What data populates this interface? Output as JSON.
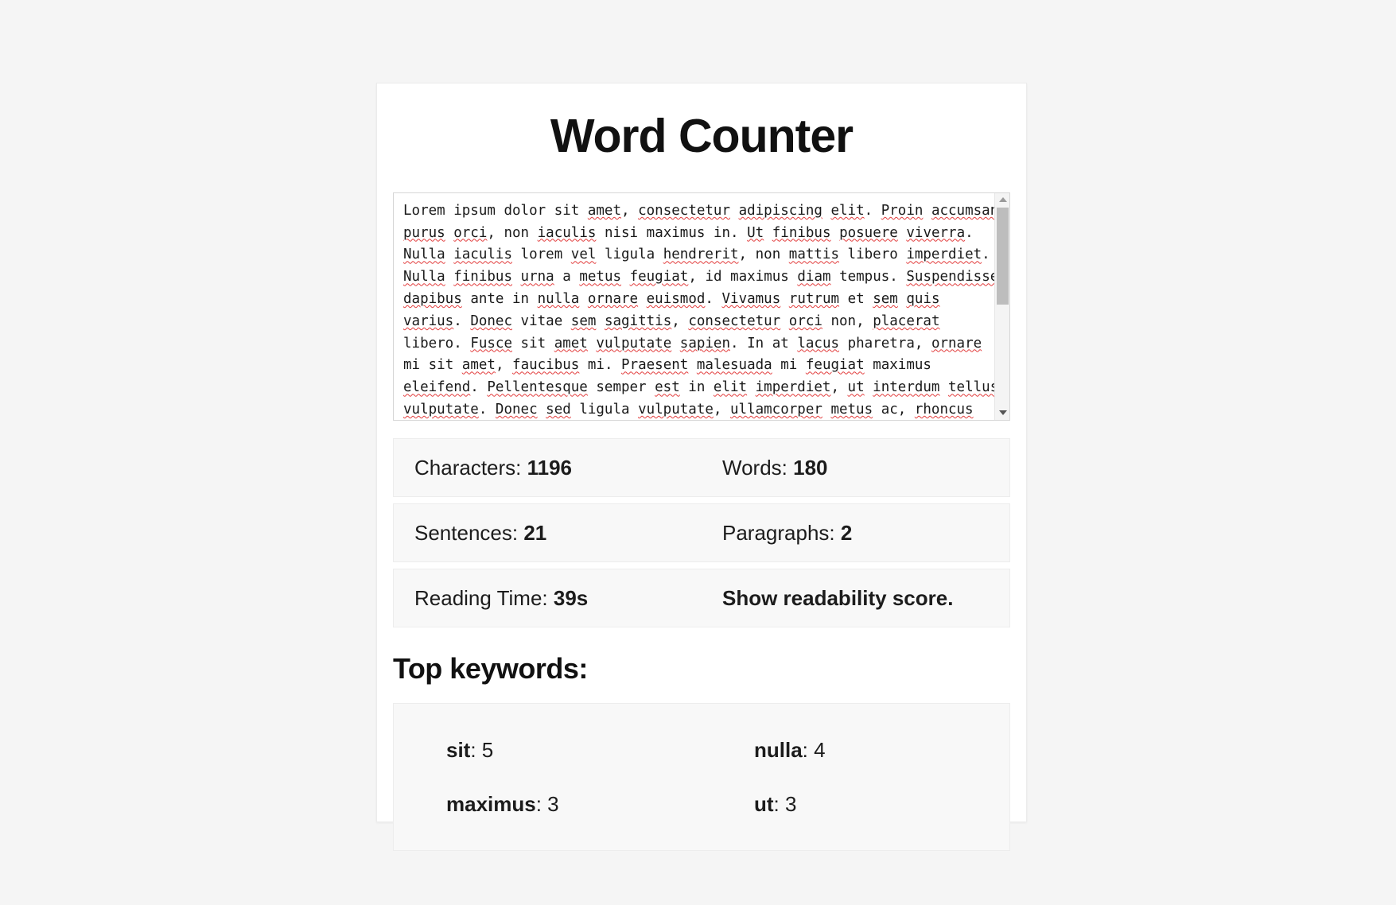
{
  "app": {
    "title": "Word Counter",
    "background_color": "#f5f5f5",
    "card_color": "#ffffff",
    "stat_box_color": "#f8f8f8",
    "spellcheck_underline_color": "#e23b3b"
  },
  "editor": {
    "lines": [
      "Lorem ipsum dolor sit amet, consectetur adipiscing elit. Proin accumsan",
      "purus orci, non iaculis nisi maximus in. Ut finibus posuere viverra.",
      "Nulla iaculis lorem vel ligula hendrerit, non mattis libero imperdiet.",
      "Nulla finibus urna a metus feugiat, id maximus diam tempus. Suspendisse",
      "dapibus ante in nulla ornare euismod. Vivamus rutrum et sem quis",
      "varius. Donec vitae sem sagittis, consectetur orci non, placerat",
      "libero. Fusce sit amet vulputate sapien. In at lacus pharetra, ornare",
      "mi sit amet, faucibus mi. Praesent malesuada mi feugiat maximus",
      "eleifend. Pellentesque semper est in elit imperdiet, ut interdum tellus",
      "vulputate. Donec sed ligula vulputate, ullamcorper metus ac, rhoncus"
    ],
    "misspelled_words": [
      "amet",
      "consectetur",
      "adipiscing",
      "elit",
      "Proin",
      "accumsan",
      "purus",
      "orci",
      "iaculis",
      "Ut",
      "finibus",
      "posuere",
      "viverra",
      "Nulla",
      "vel",
      "hendrerit",
      "mattis",
      "imperdiet",
      "urna",
      "metus",
      "feugiat",
      "diam",
      "Suspendisse",
      "dapibus",
      "nulla",
      "ornare",
      "euismod",
      "Vivamus",
      "rutrum",
      "sem",
      "quis",
      "varius",
      "Donec",
      "sagittis",
      "placerat",
      "Fusce",
      "vulputate",
      "sapien",
      "lacus",
      "faucibus",
      "Praesent",
      "malesuada",
      "eleifend",
      "Pellentesque",
      "est",
      "ut",
      "interdum",
      "tellus",
      "sed",
      "ullamcorper",
      "rhoncus"
    ]
  },
  "scrollbar": {
    "up_arrow": "scroll-up-arrow",
    "down_arrow": "scroll-down-arrow",
    "thumb": "scroll-thumb"
  },
  "stats": {
    "rows": [
      [
        {
          "label": "Characters: ",
          "value": "1196"
        },
        {
          "label": "Words: ",
          "value": "180"
        }
      ],
      [
        {
          "label": "Sentences: ",
          "value": "21"
        },
        {
          "label": "Paragraphs: ",
          "value": "2"
        }
      ],
      [
        {
          "label": "Reading Time: ",
          "value": "39s"
        },
        {
          "label": "",
          "value": "Show readability score."
        }
      ]
    ]
  },
  "keywords": {
    "heading": "Top keywords:",
    "rows": [
      [
        {
          "word": "sit",
          "count": ": 5"
        },
        {
          "word": "nulla",
          "count": ": 4"
        }
      ],
      [
        {
          "word": "maximus",
          "count": ": 3"
        },
        {
          "word": "ut",
          "count": ": 3"
        }
      ]
    ]
  }
}
